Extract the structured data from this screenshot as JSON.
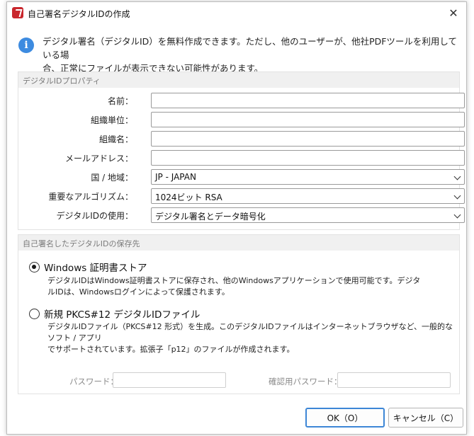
{
  "dialog": {
    "title": "自己署名デジタルIDの作成",
    "close_label": "✕"
  },
  "info": {
    "line1": "デジタル署名（デジタルID）を無料作成できます。ただし、他のユーザーが、他社PDFツールを利用している場",
    "line2": "合、正常にファイルが表示できない可能性があります。"
  },
  "properties": {
    "group_title": "デジタルIDプロパティ",
    "name_label": "名前：",
    "name_value": "",
    "org_unit_label": "組織単位：",
    "org_unit_value": "",
    "org_name_label": "組織名：",
    "org_name_value": "",
    "email_label": "メールアドレス：",
    "email_value": "",
    "country_label": "国 / 地域：",
    "country_value": "JP - JAPAN",
    "algorithm_label": "重要なアルゴリズム：",
    "algorithm_value": "1024ビット RSA",
    "usage_label": "デジタルIDの使用：",
    "usage_value": "デジタル署名とデータ暗号化"
  },
  "storage": {
    "group_title": "自己署名したデジタルIDの保存先",
    "opt1_label": "Windows 証明書ストア",
    "opt1_desc1": "デジタルIDはWindows証明書ストアに保存され、他のWindowsアプリケーションで使用可能です。デジタ",
    "opt1_desc2": "ルIDは、Windowsログインによって保護されます。",
    "opt2_label": "新規 PKCS#12 デジタルIDファイル",
    "opt2_desc1": "デジタルIDファイル（PKCS#12 形式）を生成。このデジタルIDファイルはインターネットブラウザなど、一般的なソフト / アプリ",
    "opt2_desc2": "でサポートされています。拡張子「p12」のファイルが作成されます。",
    "password_label": "パスワード：",
    "confirm_label": "確認用パスワード：",
    "selected": "opt1"
  },
  "buttons": {
    "ok": "OK（O）",
    "cancel": "キャンセル（C）"
  },
  "colors": {
    "accent": "#3d86d6",
    "info_icon": "#3d8be0",
    "app_icon": "#c9272d"
  }
}
